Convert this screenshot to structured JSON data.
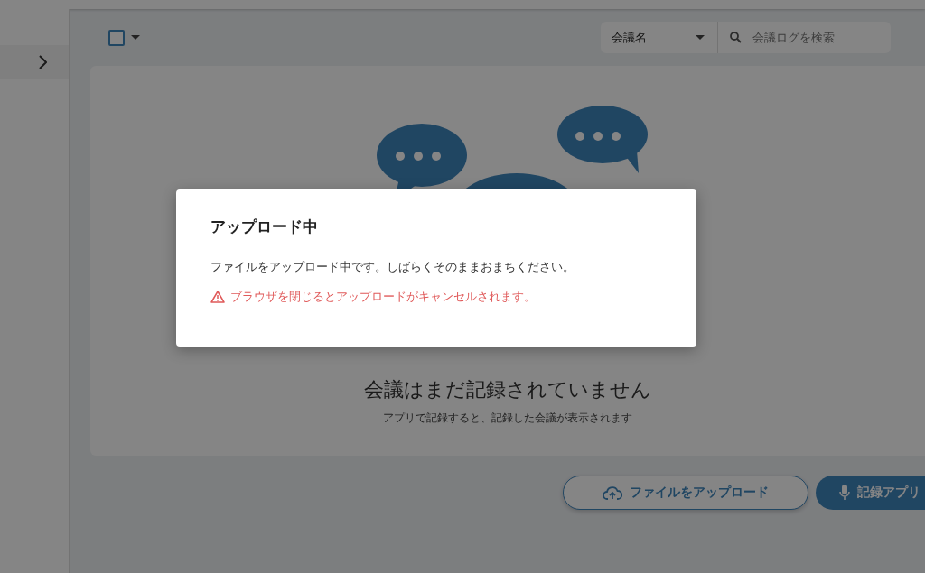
{
  "toolbar": {
    "select_all": {
      "checked": false
    },
    "filter": {
      "value": "会議名"
    },
    "search": {
      "placeholder": "会議ログを検索"
    }
  },
  "empty_state": {
    "title": "会議はまだ記録されていません",
    "message": "アプリで記録すると、記録した会議が表示されます"
  },
  "buttons": [
    {
      "kind": "outline",
      "label": "ファイルをアップロード"
    },
    {
      "kind": "primary",
      "label": "記録アプリ"
    }
  ],
  "dialog": {
    "title": "アップロード中",
    "message": "ファイルをアップロード中です。しばらくそのままおまちください。",
    "warning": "ブラウザを閉じるとアップロードがキャンセルされます。"
  }
}
